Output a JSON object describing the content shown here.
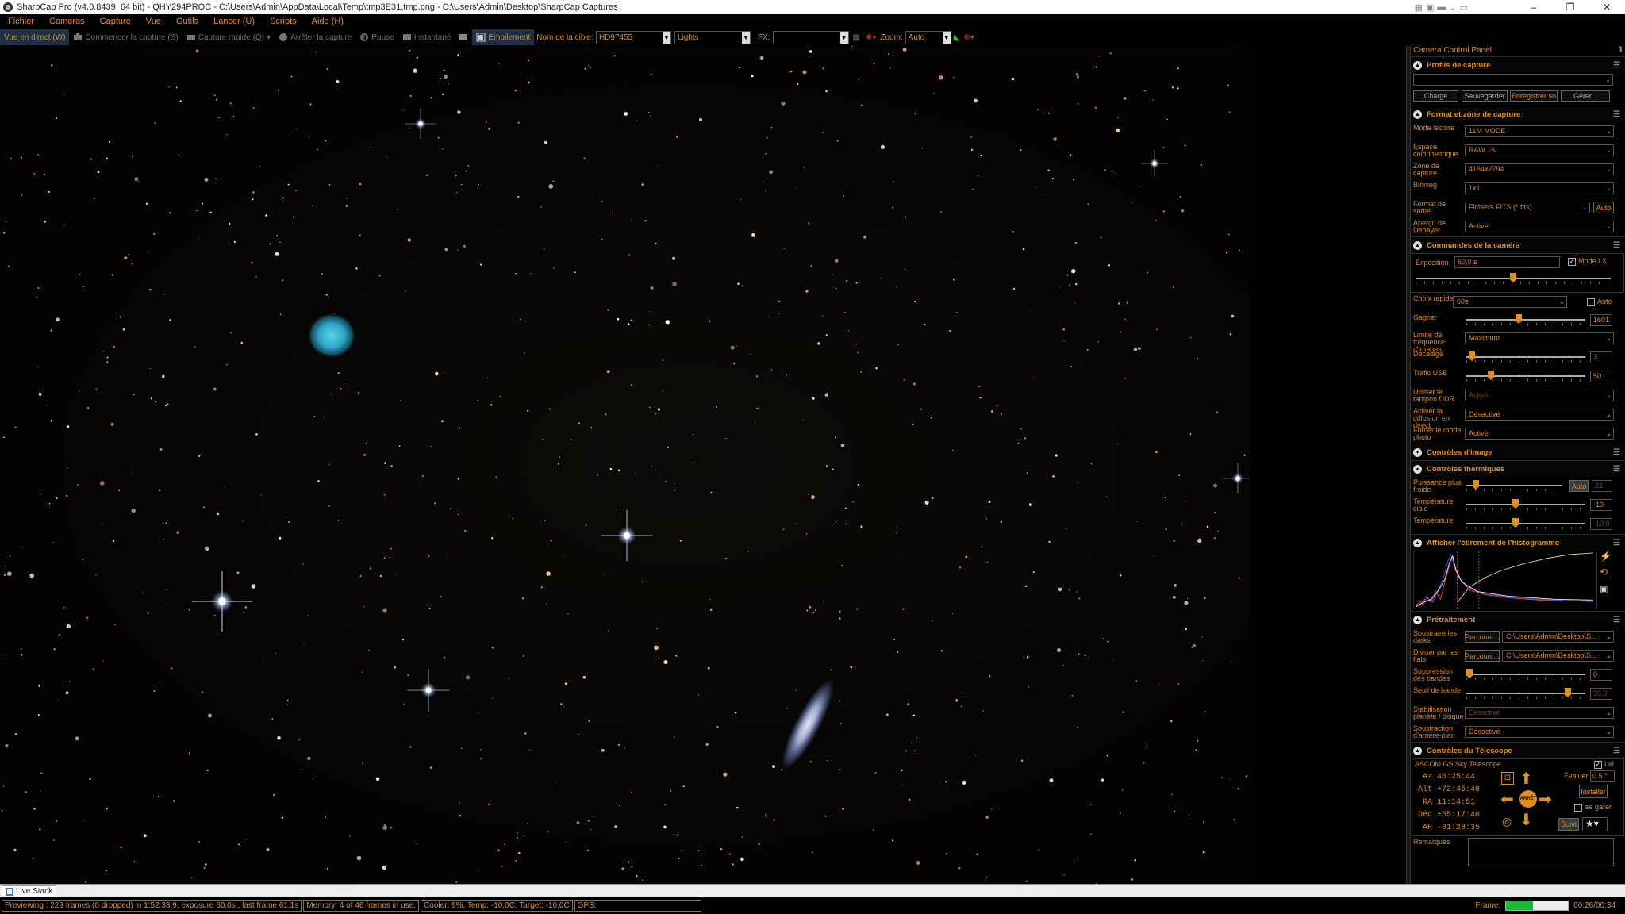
{
  "window": {
    "title": "SharpCap Pro (v4.0.8439, 64 bit) - QHY294PROC - C:\\Users\\Admin\\AppData\\Local\\Temp\\tmp3E31.tmp.png - C:\\Users\\Admin\\Desktop\\SharpCap Captures",
    "minimize": "–",
    "maximize": "❐",
    "close": "✕"
  },
  "menu": [
    "Fichier",
    "Cameras",
    "Capture",
    "Vue",
    "Outils",
    "Lancer (U)",
    "Scripts",
    "Aide (H)"
  ],
  "toolbar": {
    "live_view": "Vue en direct (W)",
    "start_capture": "Commencer la capture (S)",
    "quick_capture": "Capture rapide (Q)",
    "stop_capture": "Arrêter la capture",
    "pause": "Pause",
    "snapshot": "Instantané",
    "stacking": "Empilement",
    "target_label": "Nom de la cible:",
    "target_value": "HD97455",
    "frame_type": "Lights",
    "fx_label": "FX:",
    "fx_value": "",
    "zoom_label": "Zoom:",
    "zoom_value": "Auto"
  },
  "panel": {
    "title": "Camera Control Panel",
    "pin": "𝟭",
    "profiles": {
      "header": "Profils de capture",
      "selected": "",
      "buttons": [
        "Charge",
        "Sauvegarder",
        "Enregistrer so",
        "Gérer..."
      ]
    },
    "format": {
      "header": "Format et zone de capture",
      "rows": [
        {
          "label": "Mode lecture",
          "value": "11M MODE"
        },
        {
          "label": "Espace colorimétrique",
          "value": "RAW 16"
        },
        {
          "label": "Zone de capture",
          "value": "4164x2794"
        },
        {
          "label": "Binning",
          "value": "1x1"
        },
        {
          "label": "Format de sortie",
          "value": "Fichiers FITS (*.fits)"
        },
        {
          "label": "Aperçu de Debayer",
          "value": "Activé"
        }
      ],
      "output_auto": "Auto"
    },
    "camera": {
      "header": "Commandes de la caméra",
      "exposure_label": "Exposition",
      "exposure_value": "60,0 s",
      "lx_mode_label": "Mode LX",
      "quick_label": "Choix rapides",
      "quick_value": "60s",
      "quick_auto": "Auto",
      "gain_label": "Gagner",
      "gain_value": "1601",
      "gain_fraction": 0.44,
      "framerate_label": "Limite de fréquence d'images",
      "framerate_value": "Maximum",
      "offset_label": "Décalage",
      "offset_value": "3",
      "offset_fraction": 0.02,
      "usb_label": "Trafic USB",
      "usb_value": "50",
      "usb_fraction": 0.19,
      "ddr_label": "Utiliser le tampon DDR",
      "ddr_value": "Activé",
      "stream_label": "Activer la diffusion en direct",
      "stream_value": "Désactivé",
      "photo_label": "Forcer le mode photo",
      "photo_value": "Activé",
      "exposure_fraction": 0.5
    },
    "image_controls": {
      "header": "Contrôles d'image"
    },
    "thermal": {
      "header": "Contrôles thermiques",
      "power_label": "Puissance plus froide",
      "power_auto": "Auto",
      "power_value": "23",
      "power_fraction": 0.07,
      "target_label": "Température cible",
      "target_value": "-10",
      "target_fraction": 0.41,
      "temp_label": "Température",
      "temp_value": "-10,0",
      "temp_fraction": 0.41
    },
    "histogram": {
      "header": "Afficher l'étirement de l'histogramme"
    },
    "preprocessing": {
      "header": "Prétraitement",
      "darks_label": "Soustraire les darks",
      "darks_button": "Parcourir...",
      "darks_path": "C:\\Users\\Admin\\Desktop\\S...",
      "flats_label": "Diviser par les flats",
      "flats_button": "Parcourir...",
      "flats_path": "C:\\Users\\Admin\\Desktop\\S...",
      "banding_label": "Suppression des bandes",
      "banding_value": "0",
      "banding_fraction": 0.0,
      "threshold_label": "Seuil de bande",
      "threshold_value": "35,0",
      "threshold_fraction": 0.87,
      "stabilization_label": "Stabilisation planète / disque",
      "stabilization_value": "Désactivé",
      "background_label": "Soustraction d'arrière-plan",
      "background_value": "Désactivé"
    },
    "telescope": {
      "header": "Contrôles du Télescope",
      "name": "ASCOM GS Sky Telescope",
      "linked_label": "Lié",
      "coords": [
        {
          "k": "Az",
          "v": "46:25:44"
        },
        {
          "k": "Alt",
          "v": "+72:45:48"
        },
        {
          "k": "RA",
          "v": "11:14:51"
        },
        {
          "k": "Déc",
          "v": "+55:17:40"
        },
        {
          "k": "AH",
          "v": "-01:28:35"
        }
      ],
      "rate_label": "Évaluer",
      "rate_value": "0.5 °",
      "install_button": "Installer",
      "park_label": "se garer",
      "follow_button": "Suivi",
      "center_label": "ARRÊT"
    },
    "notes": {
      "label": "Remarques",
      "value": ""
    }
  },
  "bottom": {
    "tab": "Live Stack"
  },
  "status": {
    "preview": "Previewing : 229 frames (0 dropped) in 1:52:33,9, exposure 60,0s , last frame 61,1s",
    "memory": "Memory: 4 of 46 frames in use.",
    "cooler": "Cooler: 9%, Temp: -10,0C, Target: -10,0C",
    "gps": "GPS:",
    "frame_label": "Frame:",
    "frame_progress": 0.44,
    "frame_time": "00:26/00:34"
  }
}
